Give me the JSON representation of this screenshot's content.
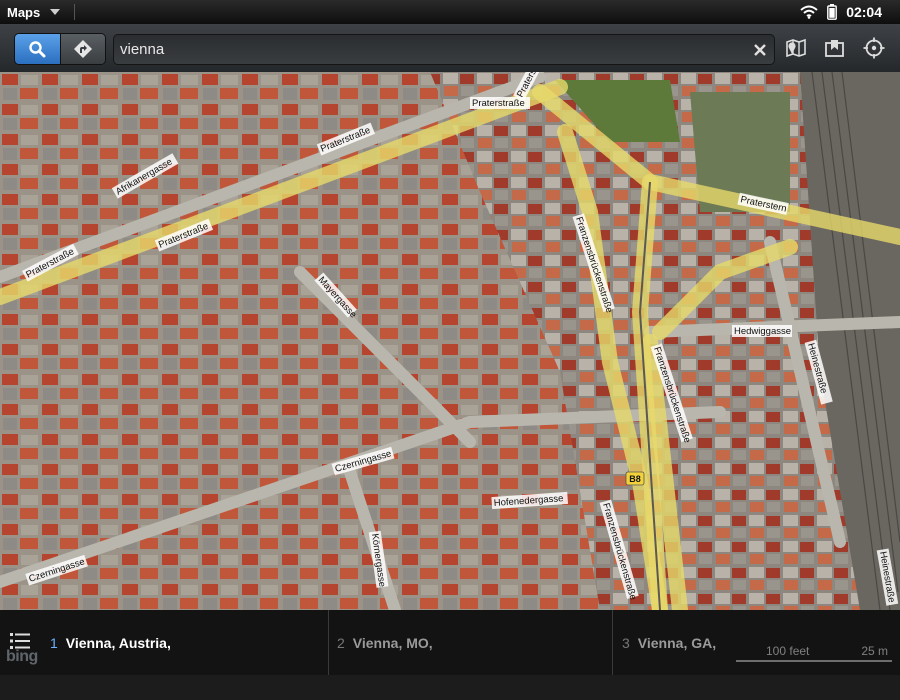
{
  "status_bar": {
    "app_name": "Maps",
    "time": "02:04"
  },
  "toolbar": {
    "search_mode_icon": "search-icon",
    "directions_mode_icon": "directions-icon",
    "search_value": "vienna",
    "clear_icon": "clear-icon",
    "right_icons": [
      "layers-icon",
      "bookmarks-icon",
      "locate-icon"
    ]
  },
  "map": {
    "street_labels": [
      "Praterstern",
      "Praterstraße",
      "Praterstraße",
      "Praterstraße",
      "Praterstraße",
      "Afrikanergasse",
      "Praterstern",
      "Franzensbrückenstraße",
      "Franzensbrückenstraße",
      "Franzensbrückenstraße",
      "Mayergasse",
      "Hedwiggasse",
      "Heinestraße",
      "Czerningasse",
      "Czerningasse",
      "Hofenedergasse",
      "Körnergasse",
      "Heinestraße"
    ],
    "route_badge": "B8",
    "accent_color": "#e7d96a"
  },
  "results": {
    "items": [
      {
        "num": "1",
        "label": "Vienna, Austria,"
      },
      {
        "num": "2",
        "label": "Vienna, MO,"
      },
      {
        "num": "3",
        "label": "Vienna, GA,"
      }
    ],
    "attribution": "bing",
    "scale_feet": "100 feet",
    "scale_m": "25 m"
  }
}
